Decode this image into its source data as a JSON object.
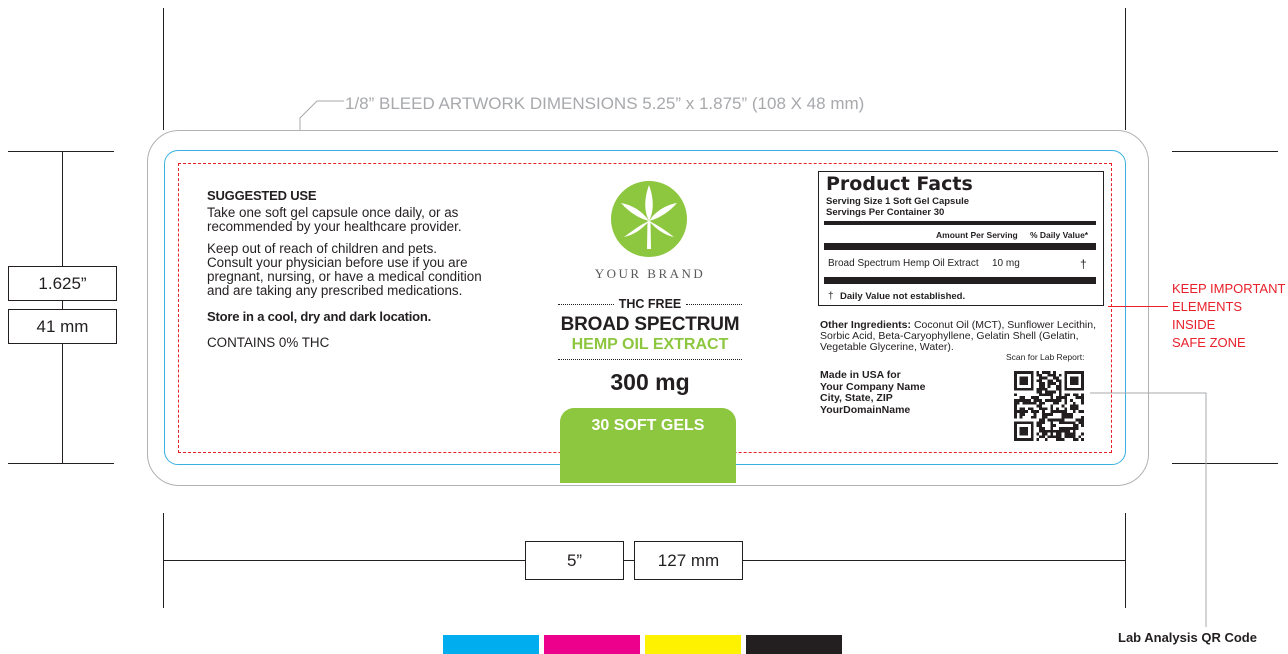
{
  "bleed_label": "1/8” BLEED ARTWORK DIMENSIONS 5.25” x 1.875” (108 X 48 mm)",
  "dimensions": {
    "height_in": "1.625”",
    "height_mm": "41 mm",
    "width_in": "5”",
    "width_mm": "127 mm"
  },
  "suggested_use": {
    "heading": "SUGGESTED USE",
    "line1": "Take one soft gel capsule once daily, or as",
    "line2": "recommended by your healthcare provider.",
    "warn1": "Keep out of reach of children and pets.",
    "warn2": "Consult your physician before use if you are",
    "warn3": "pregnant, nursing, or have a medical condition",
    "warn4": "and are taking any prescribed medications.",
    "storage": "Store in a cool, dry and dark location.",
    "thc": "CONTAINS 0% THC"
  },
  "brand": {
    "name": "YOUR BRAND",
    "thc_free": "THC FREE",
    "line1": "BROAD SPECTRUM",
    "line2": "HEMP OIL EXTRACT",
    "strength": "300 mg",
    "count": "30 SOFT GELS",
    "green": "#8dc63f",
    "logo_icon": "cannabis-leaf-logo-icon"
  },
  "facts": {
    "title": "Product Facts",
    "serving_size": "Serving Size 1 Soft Gel Capsule",
    "servings_per": "Servings Per Container 30",
    "col_amount": "Amount Per Serving",
    "col_dv": "% Daily Value*",
    "row_name": "Broad Spectrum Hemp Oil Extract",
    "row_amount": "10 mg",
    "row_dv": "†",
    "footnote_mark": "†",
    "footnote": "Daily Value not established."
  },
  "ingredients": {
    "label": "Other Ingredients:",
    "line1": "Coconut Oil (MCT), Sunflower Lecithin,",
    "line2": "Sorbic Acid, Beta-Caryophyllene, Gelatin Shell (Gelatin,",
    "line3": "Vegetable Glycerine, Water)."
  },
  "scan_label": "Scan for Lab Report:",
  "made_in": {
    "line1": "Made in USA for",
    "line2": "Your Company Name",
    "line3": "City, State, ZIP",
    "line4": "YourDomainName"
  },
  "safe_zone_note": {
    "line1": "KEEP IMPORTANT",
    "line2": "ELEMENTS INSIDE",
    "line3": "SAFE ZONE"
  },
  "qr_label": "Lab Analysis QR Code",
  "swatches": {
    "cyan": "#00aeef",
    "magenta": "#ec008c",
    "yellow": "#fff200",
    "black": "#231f20"
  }
}
